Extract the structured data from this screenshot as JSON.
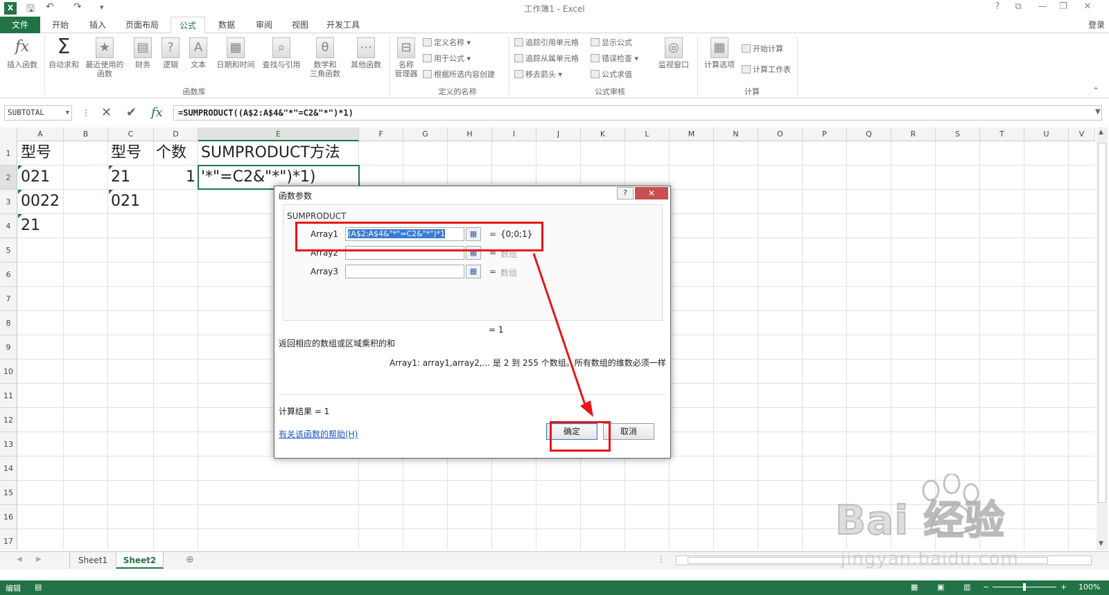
{
  "window": {
    "title": "工作簿1 - Excel",
    "login": "登录",
    "help": "?",
    "restore": "⧉",
    "minimize": "—",
    "maximize": "❐",
    "close": "✕"
  },
  "tabs": [
    "文件",
    "开始",
    "插入",
    "页面布局",
    "公式",
    "数据",
    "审阅",
    "视图",
    "开发工具"
  ],
  "active_tab": "公式",
  "ribbon": {
    "big_buttons": [
      "插入函数",
      "自动求和",
      "最近使用的\n函数",
      "财务",
      "逻辑",
      "文本",
      "日期和时间",
      "查找与引用",
      "数学和\n三角函数",
      "其他函数",
      "名称\n管理器",
      "监视窗口",
      "计算选项"
    ],
    "small_buttons": [
      "定义名称",
      "用于公式",
      "根据所选内容创建",
      "追踪引用单元格",
      "追踪从属单元格",
      "移去箭头",
      "显示公式",
      "错误检查",
      "公式求值",
      "开始计算",
      "计算工作表"
    ],
    "groups": [
      "函数库",
      "定义的名称",
      "公式审核",
      "计算"
    ]
  },
  "formula_bar": {
    "name_box": "SUBTOTAL",
    "formula": "=SUMPRODUCT((A$2:A$4&\"*\"=C2&\"*\")*1)"
  },
  "grid": {
    "columns": [
      "A",
      "B",
      "C",
      "D",
      "E",
      "F",
      "G",
      "H",
      "I",
      "J",
      "K",
      "L",
      "M",
      "N",
      "O",
      "P",
      "Q",
      "R",
      "S",
      "T",
      "U",
      "V"
    ],
    "rows": [
      "1",
      "2",
      "3",
      "4",
      "5",
      "6",
      "7",
      "8",
      "9",
      "10",
      "11",
      "12",
      "13",
      "14",
      "15",
      "16",
      "17"
    ],
    "cells": {
      "A1": "型号",
      "C1": "型号",
      "D1": "个数",
      "E1": "SUMPRODUCT方法",
      "A2": "021",
      "C2": "21",
      "D2": "1",
      "E2": "'*\"=C2&\"*\")*1)",
      "A3": "0022",
      "C3": "021",
      "A4": "21"
    }
  },
  "sheets": [
    "Sheet1",
    "Sheet2"
  ],
  "active_sheet": "Sheet2",
  "status": {
    "mode": "编辑",
    "zoom": "100%"
  },
  "dialog": {
    "title": "函数参数",
    "help_btn": "?",
    "close_btn": "✕",
    "function_name": "SUMPRODUCT",
    "args": [
      {
        "label": "Array1",
        "value": "(A$2:A$4&\"*\"=C2&\"*\")*1",
        "eq": "=",
        "result": "{0;0;1}"
      },
      {
        "label": "Array2",
        "value": "",
        "eq": "=",
        "result": "数组"
      },
      {
        "label": "Array3",
        "value": "",
        "eq": "=",
        "result": "数组"
      }
    ],
    "formula_result_line": "=  1",
    "description": "返回相应的数组或区域乘积的和",
    "arg_description": "Array1:  array1,array2,... 是 2 到 255 个数组。所有数组的维数必须一样",
    "calc_result": "计算结果 =   1",
    "help_link": "有关该函数的帮助(H)",
    "ok": "确定",
    "cancel": "取消"
  },
  "watermark": {
    "brand": "Bai 经验",
    "url": "jingyan.baidu.com"
  },
  "colors": {
    "excel_green": "#217346",
    "annotation_red": "#e8141a"
  }
}
